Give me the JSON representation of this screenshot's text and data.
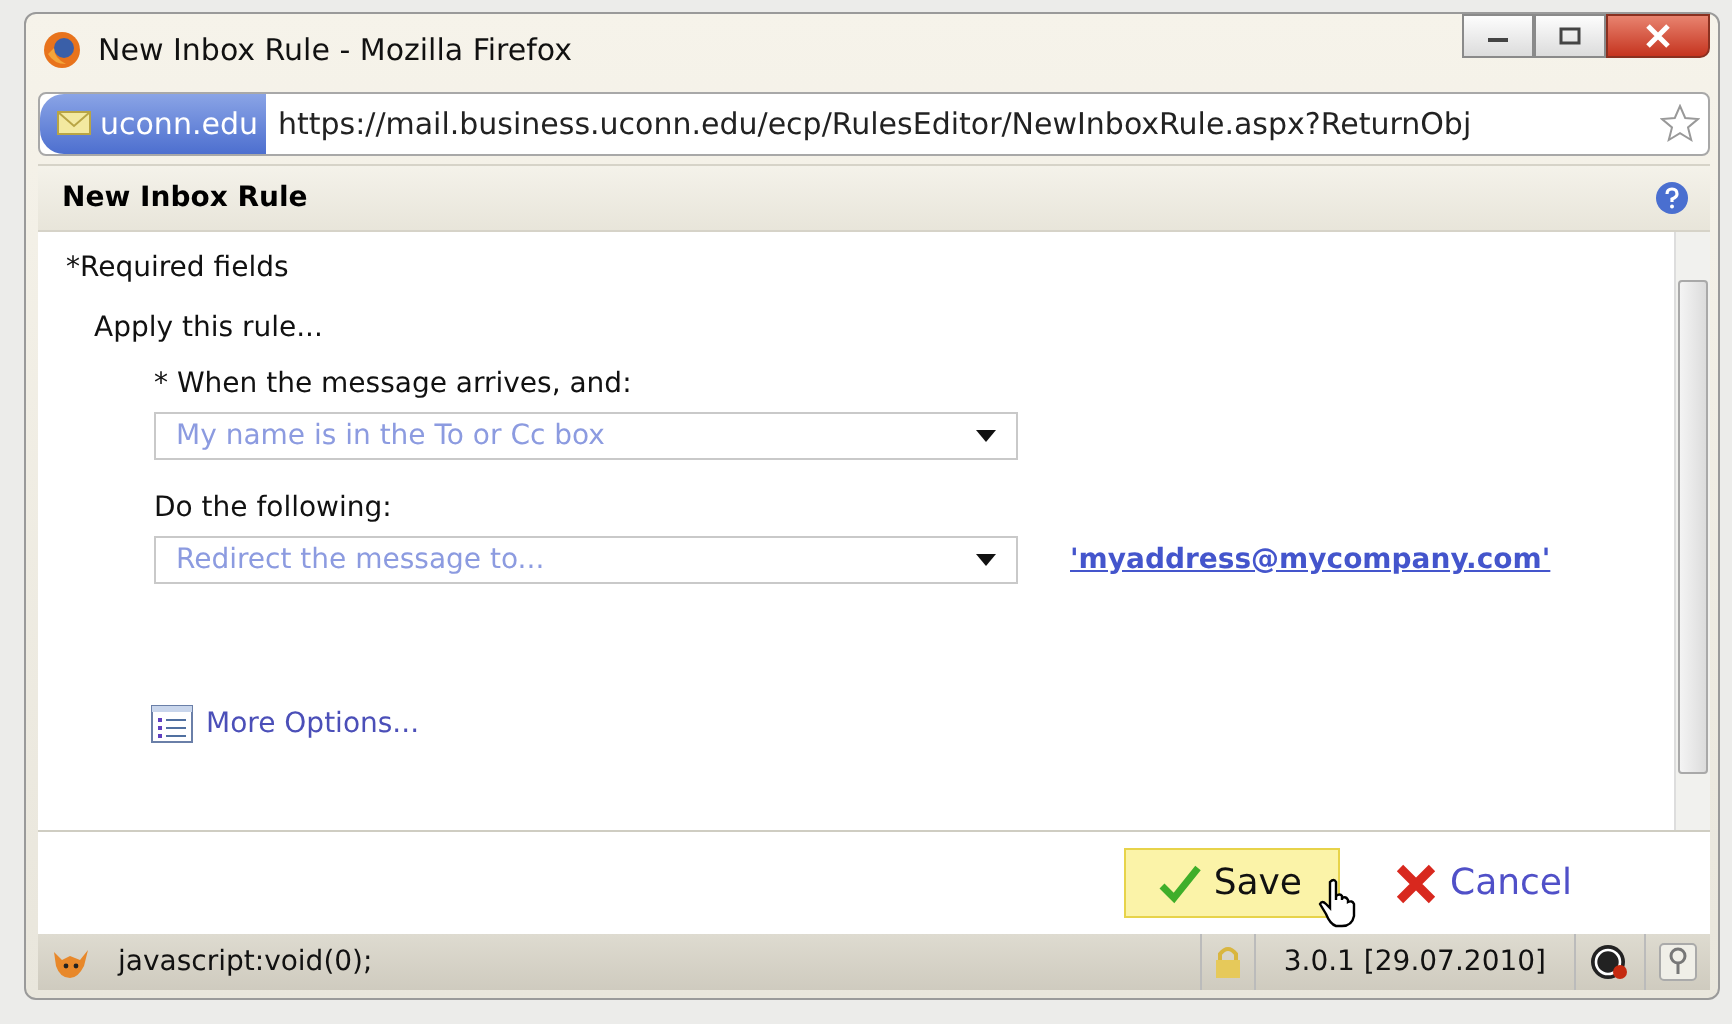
{
  "window": {
    "title": "New Inbox Rule - Mozilla Firefox"
  },
  "address_bar": {
    "site": "uconn.edu",
    "url": "https://mail.business.uconn.edu/ecp/RulesEditor/NewInboxRule.aspx?ReturnObj"
  },
  "panel": {
    "title": "New Inbox Rule"
  },
  "form": {
    "required_note": "*Required fields",
    "section": "Apply this rule...",
    "fields": [
      {
        "label": "* When the message arrives, and:",
        "placeholder": "My name is in the To or Cc box"
      },
      {
        "label": "Do the following:",
        "placeholder": "Redirect the message to...",
        "link": "'myaddress@mycompany.com'"
      }
    ],
    "more_options": "More Options..."
  },
  "buttons": [
    {
      "kind": "save",
      "label": "Save",
      "highlighted": true
    },
    {
      "kind": "cancel",
      "label": "Cancel",
      "highlighted": false
    }
  ],
  "status_bar": {
    "text": "javascript:void(0);",
    "version": "3.0.1 [29.07.2010]"
  }
}
